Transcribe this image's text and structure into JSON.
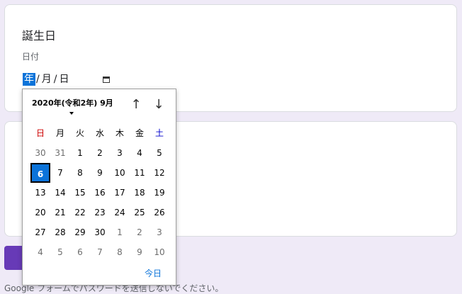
{
  "question": {
    "title": "誕生日",
    "subtitle": "日付"
  },
  "date_input": {
    "year": "年",
    "month": "月",
    "day": "日",
    "separator": "/"
  },
  "footer": {
    "text": "Google フォームでパスワードを送信しないでください。"
  },
  "picker": {
    "month_label": "2020年(令和2年) 9月",
    "nav_up": "↑",
    "nav_down": "↓",
    "weekdays": [
      "日",
      "月",
      "火",
      "水",
      "木",
      "金",
      "土"
    ],
    "weeks": [
      [
        "30",
        "31",
        "1",
        "2",
        "3",
        "4",
        "5"
      ],
      [
        "6",
        "7",
        "8",
        "9",
        "10",
        "11",
        "12"
      ],
      [
        "13",
        "14",
        "15",
        "16",
        "17",
        "18",
        "19"
      ],
      [
        "20",
        "21",
        "22",
        "23",
        "24",
        "25",
        "26"
      ],
      [
        "27",
        "28",
        "29",
        "30",
        "1",
        "2",
        "3"
      ],
      [
        "4",
        "5",
        "6",
        "7",
        "8",
        "9",
        "10"
      ]
    ],
    "today_label": "今日",
    "selected_day": "6"
  },
  "colors": {
    "accent": "#0b73d9",
    "brand": "#673ab7",
    "background": "#efeaf7"
  }
}
